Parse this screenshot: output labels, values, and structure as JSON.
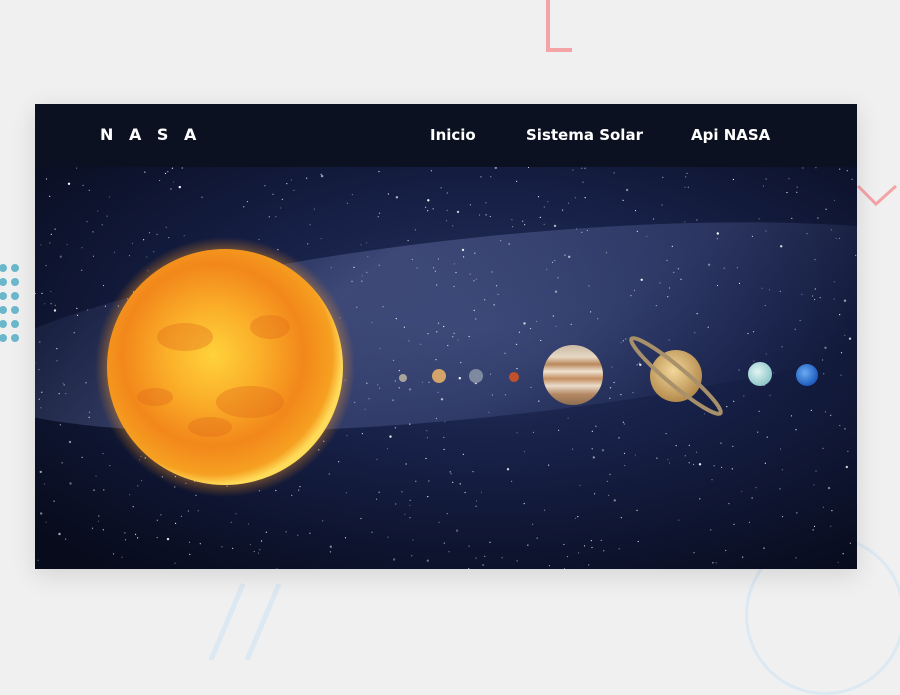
{
  "nav": {
    "brand": "N A S A",
    "links": [
      "Inicio",
      "Sistema Solar",
      "Api NASA"
    ]
  },
  "hero": {
    "image": "solar-system",
    "bodies": [
      "sun",
      "mercury",
      "venus",
      "earth",
      "mars",
      "jupiter",
      "saturn",
      "uranus",
      "neptune"
    ]
  },
  "colors": {
    "navbar": "#0b1120",
    "page": "#f0f0f0",
    "space": "#0c1330",
    "sun": "#f9a21b",
    "accent_pink": "#f4a3a6",
    "accent_blue": "#5fb0c8"
  }
}
